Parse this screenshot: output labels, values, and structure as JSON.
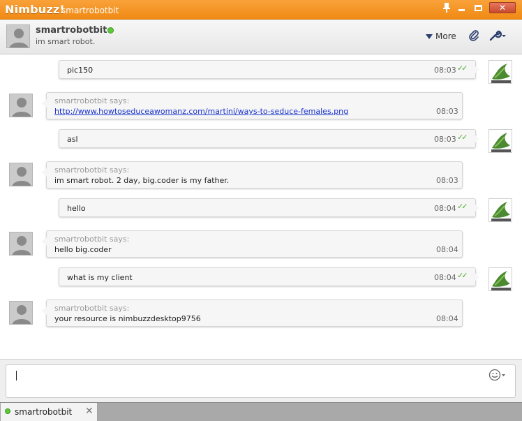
{
  "window": {
    "brand": "Nimbuzz!",
    "title": "smartrobotbit",
    "buttons": {
      "pin": "pin-icon",
      "minimize": "minimize-icon",
      "maximize": "maximize-icon",
      "close": "close-icon"
    }
  },
  "header": {
    "name": "smartrobotbit",
    "status_text": "im smart robot.",
    "presence": "online",
    "more_label": "More"
  },
  "messages": [
    {
      "direction": "out",
      "text": "pic150",
      "time": "08:03",
      "delivered": true
    },
    {
      "direction": "in",
      "sender": "smartrobotbit says:",
      "text": "http://www.howtoseduceawomanz.com/martini/ways-to-seduce-females.png",
      "is_link": true,
      "time": "08:03"
    },
    {
      "direction": "out",
      "text": "asl",
      "time": "08:03",
      "delivered": true
    },
    {
      "direction": "in",
      "sender": "smartrobotbit says:",
      "text": "im smart robot. 2 day, big.coder is my father.",
      "time": "08:03"
    },
    {
      "direction": "out",
      "text": "hello",
      "time": "08:04",
      "delivered": true
    },
    {
      "direction": "in",
      "sender": "smartrobotbit says:",
      "text": "hello big.coder",
      "time": "08:04"
    },
    {
      "direction": "out",
      "text": "what is my client",
      "time": "08:04",
      "delivered": true
    },
    {
      "direction": "in",
      "sender": "smartrobotbit says:",
      "text": "your resource is nimbuzzdesktop9756",
      "time": "08:04"
    }
  ],
  "composer": {
    "value": "",
    "emoticon_icon": "smiley-icon"
  },
  "tabs": [
    {
      "label": "smartrobotbit",
      "presence": "online"
    }
  ],
  "colors": {
    "titlebar": "#f08a14",
    "online": "#5cc83a",
    "link": "#1a33cc",
    "tick": "#4caa2e"
  }
}
